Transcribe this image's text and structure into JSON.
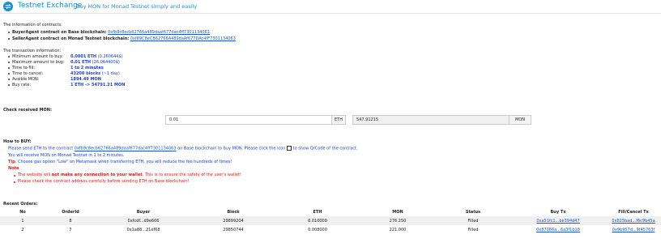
{
  "header": {
    "title": "Testnet Exchange",
    "subtitle": "Buy MON for Monad Testnet simply and easily"
  },
  "contracts": {
    "heading": "The information of contracts:",
    "buyer_label": "BuyerAgent contract on Base blockchain:",
    "buyer_address": "0xfb9c8ecb62766a489daaf677dac4ff7301134063",
    "seller_label": "SellerAgent contract on Monad Testnet blockchain:",
    "seller_address": "0xf89C8eCB62766A489daAf677DAc4fF7301134063"
  },
  "transaction": {
    "heading": "The transaction information:",
    "rows": [
      {
        "label": "Minimum amount to buy:",
        "value": "0.0001 ETH",
        "extra": " (0.260644$)"
      },
      {
        "label": "Maximum amount to buy:",
        "value": "0.01 ETH",
        "extra": " (26.064400$)"
      },
      {
        "label": "Time to fill:",
        "value": "1 to 2 minutes",
        "extra": ""
      },
      {
        "label": "Time to cancel:",
        "value": "43200 blocks",
        "extra": " (~1 day)"
      },
      {
        "label": "Avaible MON:",
        "value": "1894.49 MON",
        "extra": ""
      },
      {
        "label": "Buy rate:",
        "value": "1 ETH -> 54791.21 MON",
        "extra": ""
      }
    ]
  },
  "check": {
    "heading": "Check received MON:",
    "eth_value": "0.01",
    "eth_unit": "ETH",
    "mon_value": "547.91215",
    "mon_unit": "MON"
  },
  "howto": {
    "heading": "How to BUY:",
    "line1_a": "Please send ETH to the contract ",
    "line1_link": "0xfb9c8ecb62766a489daaf677dac4ff7301134063",
    "line1_b": " on Base blockchain to buy MON. Please click the icon ",
    "line1_c": " to show QrCode of the contract.",
    "line2": "You will receive MON on Monad Testnet in 1 to 2 minutes.",
    "tip_label": "Tip",
    "tip_text": ": Choose gas option \"Low\" on Metamask when transferring ETH, you will reduce the fee hundreds of times!",
    "note_label": "Note",
    "note1_a": "The website will ",
    "note1_bold": "not make any connection to your wallet",
    "note1_b": ". This is to ensure the safety of the user's wallet!",
    "note2": "Please check the contract address carefully before sending ETH on Base blockchain!"
  },
  "orders": {
    "heading": "Recent Orders:",
    "columns": [
      "No",
      "OrderId",
      "Buyer",
      "Block",
      "ETH",
      "MON",
      "Status",
      "Buy Tx",
      "Fill/Cancel Tx"
    ],
    "rows": [
      {
        "no": "1",
        "order_id": "8",
        "buyer": "0xfcdf...d9e606",
        "block": "29899204",
        "eth": "0.010000",
        "mon": "276.250",
        "status": "Filled",
        "buy_tx": "0xa51fc1...be394d47",
        "fill_tx": "0x825bad...f6c9b45a"
      },
      {
        "no": "2",
        "order_id": "7",
        "buyer": "0x1a88...21ef68",
        "block": "29850744",
        "eth": "0.008000",
        "mon": "221.000",
        "status": "Filled",
        "buy_tx": "0x87086a...6a3f1b18",
        "fill_tx": "0x9b957d...9f45763f"
      }
    ]
  }
}
